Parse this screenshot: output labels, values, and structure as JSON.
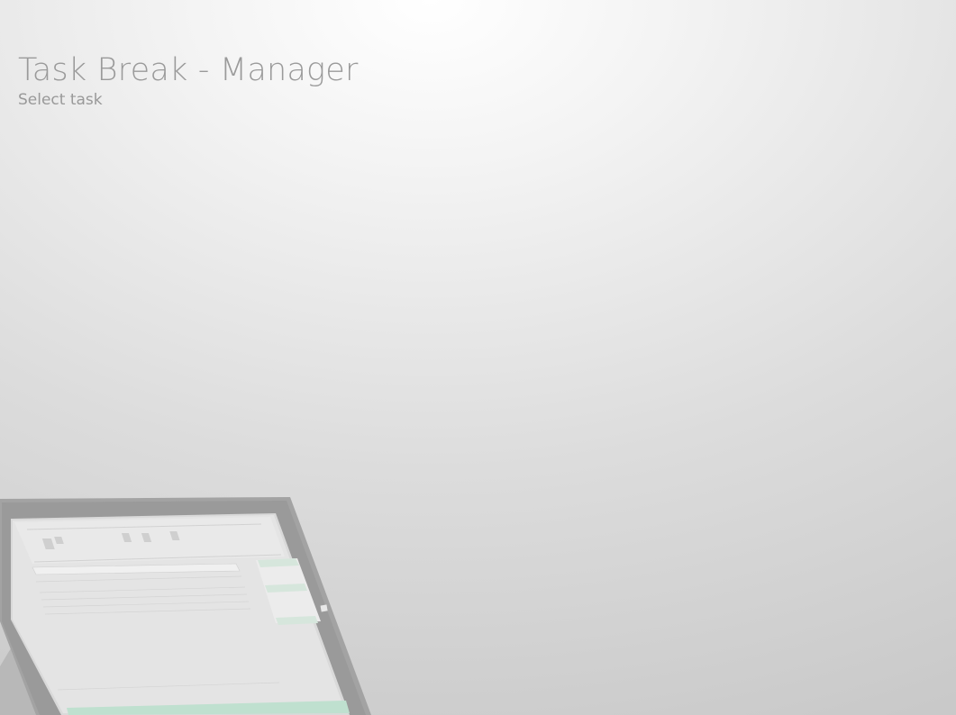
{
  "header": {
    "title": "Task Break - Manager",
    "subtitle": "Select task"
  },
  "illustration": {
    "icon": "tablet-device-icon",
    "screen_accent": "#bfe0cf"
  },
  "colors": {
    "title_text": "#9a9a9a",
    "background_light": "#ffffff",
    "background_dark": "#c9c9c9",
    "tablet_bezel": "#9f9f9f"
  }
}
